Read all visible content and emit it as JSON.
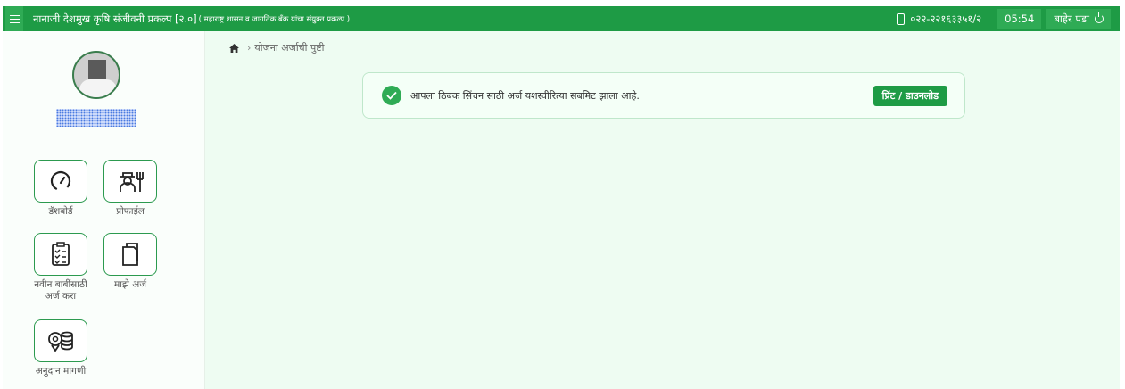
{
  "header": {
    "title": "नानाजी देशमुख कृषि संजीवनी प्रकल्प [२.०]",
    "subtitle": "( महाराष्ट्र शासन व जागतिक बँक यांचा संयुक्त प्रकल्प )",
    "phone": "०२२-२२१६३३५१/२",
    "clock": "05:54",
    "logout_label": "बाहेर पडा",
    "accent_color": "#1e9b45"
  },
  "sidebar": {
    "tiles": [
      {
        "label": "डॅशबोर्ड",
        "icon": "speedometer-icon"
      },
      {
        "label": "प्रोफाईल",
        "icon": "farmer-profile-icon"
      },
      {
        "label": "नवीन बाबींसाठी अर्ज करा",
        "icon": "checklist-icon"
      },
      {
        "label": "माझे अर्ज",
        "icon": "documents-icon"
      },
      {
        "label": "अनुदान मागणी",
        "icon": "coins-icon"
      }
    ]
  },
  "breadcrumb": {
    "current": "योजना अर्जाची पुष्टी"
  },
  "alert": {
    "message": "आपला ठिबक सिंचन साठी अर्ज यशस्वीरित्या सबमिट झाला आहे.",
    "button_label": "प्रिंट / डाउनलोड"
  }
}
